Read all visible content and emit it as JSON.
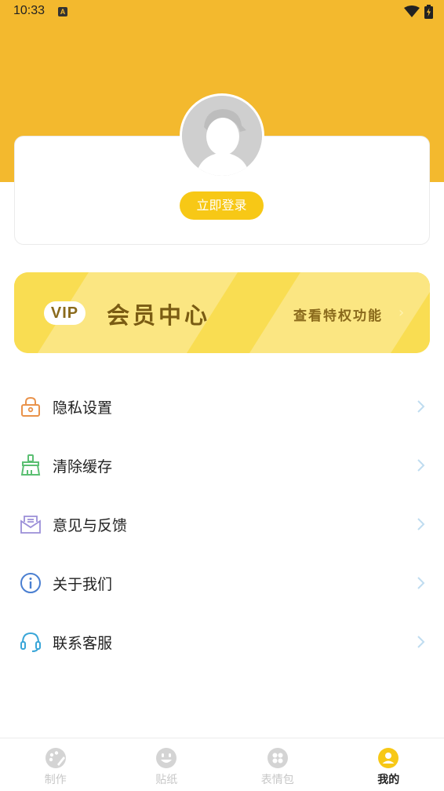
{
  "status_bar": {
    "time": "10:33",
    "notification_icon": "a-notification-icon",
    "wifi_icon": "wifi-icon",
    "battery_icon": "battery-charging-icon"
  },
  "profile": {
    "avatar_icon": "default-avatar-icon",
    "login_label": "立即登录"
  },
  "vip": {
    "tag": "VIP",
    "title": "会员中心",
    "subtitle": "查看特权功能",
    "chevron": "›"
  },
  "menu": {
    "items": [
      {
        "label": "隐私设置",
        "icon": "lock-icon",
        "color": "#e9924a"
      },
      {
        "label": "清除缓存",
        "icon": "broom-icon",
        "color": "#5bbf72"
      },
      {
        "label": "意见与反馈",
        "icon": "mail-icon",
        "color": "#9b8fd8"
      },
      {
        "label": "关于我们",
        "icon": "info-icon",
        "color": "#4a7fd1"
      },
      {
        "label": "联系客服",
        "icon": "headset-icon",
        "color": "#3aa6d8"
      }
    ]
  },
  "tabs": [
    {
      "label": "制作",
      "icon": "palette-icon",
      "active": false
    },
    {
      "label": "贴纸",
      "icon": "smile-icon",
      "active": false
    },
    {
      "label": "表情包",
      "icon": "grid-icon",
      "active": false
    },
    {
      "label": "我的",
      "icon": "user-icon",
      "active": true
    }
  ],
  "colors": {
    "header": "#f3b92e",
    "accent": "#f7c816",
    "vip_bg": "#f9dd52",
    "chevron": "#bfdcf0",
    "tab_inactive": "#c7c7c7"
  }
}
